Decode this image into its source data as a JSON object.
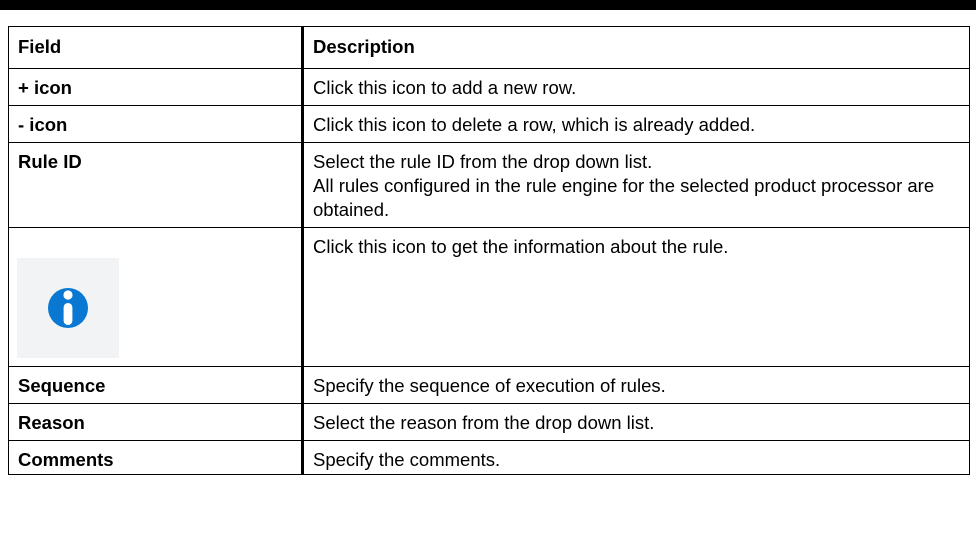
{
  "table": {
    "headers": {
      "field": "Field",
      "description": "Description"
    },
    "rows": [
      {
        "field": "+ icon",
        "description": [
          "Click this icon to add a new row."
        ]
      },
      {
        "field": "- icon",
        "description": [
          "Click this icon to delete a row, which is already added."
        ]
      },
      {
        "field": "Rule ID",
        "description": [
          "Select the rule ID from the drop down list.",
          "All rules configured in the rule engine for the selected product processor are obtained."
        ]
      },
      {
        "field_icon": "info-icon",
        "description": [
          "Click this icon to get the information about the rule."
        ]
      },
      {
        "field": "Sequence",
        "description": [
          "Specify the sequence of execution of rules."
        ]
      },
      {
        "field": "Reason",
        "description": [
          "Select the reason from the drop down list."
        ]
      },
      {
        "field": "Comments",
        "description": [
          "Specify the comments."
        ]
      }
    ]
  },
  "colors": {
    "info_icon": "#0a78d2",
    "info_icon_background": "#f1f3f5",
    "border": "#000000"
  }
}
